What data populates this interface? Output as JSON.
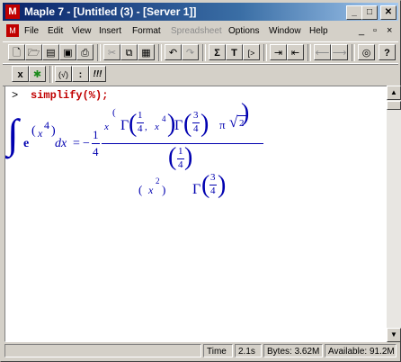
{
  "window": {
    "title": "Maple 7 - [Untitled (3) - [Server 1]]"
  },
  "titlebar_buttons": {
    "minimize": "_",
    "maximize": "□",
    "close": "✕"
  },
  "menu": {
    "items": [
      "File",
      "Edit",
      "View",
      "Insert",
      "Format",
      "Spreadsheet",
      "Options",
      "Window",
      "Help"
    ],
    "disabled": [
      "Spreadsheet"
    ],
    "doc_controls": [
      "_",
      "▫",
      "×"
    ]
  },
  "toolbar1": {
    "icons": [
      "new-icon",
      "open-icon",
      "open-url-icon",
      "save-icon",
      "print-icon",
      "cut-icon",
      "copy-icon",
      "paste-icon",
      "undo-icon",
      "redo-icon",
      "sigma-icon",
      "text-icon",
      "prompt-icon",
      "indent-icon",
      "outdent-icon",
      "back-icon",
      "forward-icon",
      "stop-icon",
      "help-icon"
    ],
    "glyphs": [
      "🗋",
      "🗁",
      "▤",
      "▣",
      "⎙",
      "✂",
      "⧉",
      "▦",
      "↶",
      "↷",
      "Σ",
      "T",
      "[>",
      "⇥",
      "⇤",
      "⟵",
      "⟶",
      "◎",
      "?"
    ]
  },
  "toolbar2": {
    "icons": [
      "x-icon",
      "maple-leaf-icon",
      "check-icon",
      "colon-icon",
      "execute-icon"
    ],
    "glyphs": [
      "x",
      "✱",
      "(√)",
      ":",
      "!!!"
    ]
  },
  "worksheet": {
    "prompt": ">",
    "command": "simplify(%);",
    "output": {
      "integral": "∫",
      "e": "e",
      "x": "x",
      "four": "4",
      "dx": "dx",
      "equals": "=",
      "minus": "−",
      "one": "1",
      "comma": ",",
      "three": "3",
      "gamma": "Γ",
      "pi": "π",
      "two": "2",
      "paren_open": "(",
      "paren_close": ")",
      "sqrt": "√"
    }
  },
  "status": {
    "time_label": "Time",
    "time_value": "2.1s",
    "bytes": "Bytes: 3.62M",
    "available": "Available: 91.2M"
  },
  "colors": {
    "command": "#c00000",
    "math_output": "#0000b0",
    "title_gradient_start": "#0a246a"
  }
}
